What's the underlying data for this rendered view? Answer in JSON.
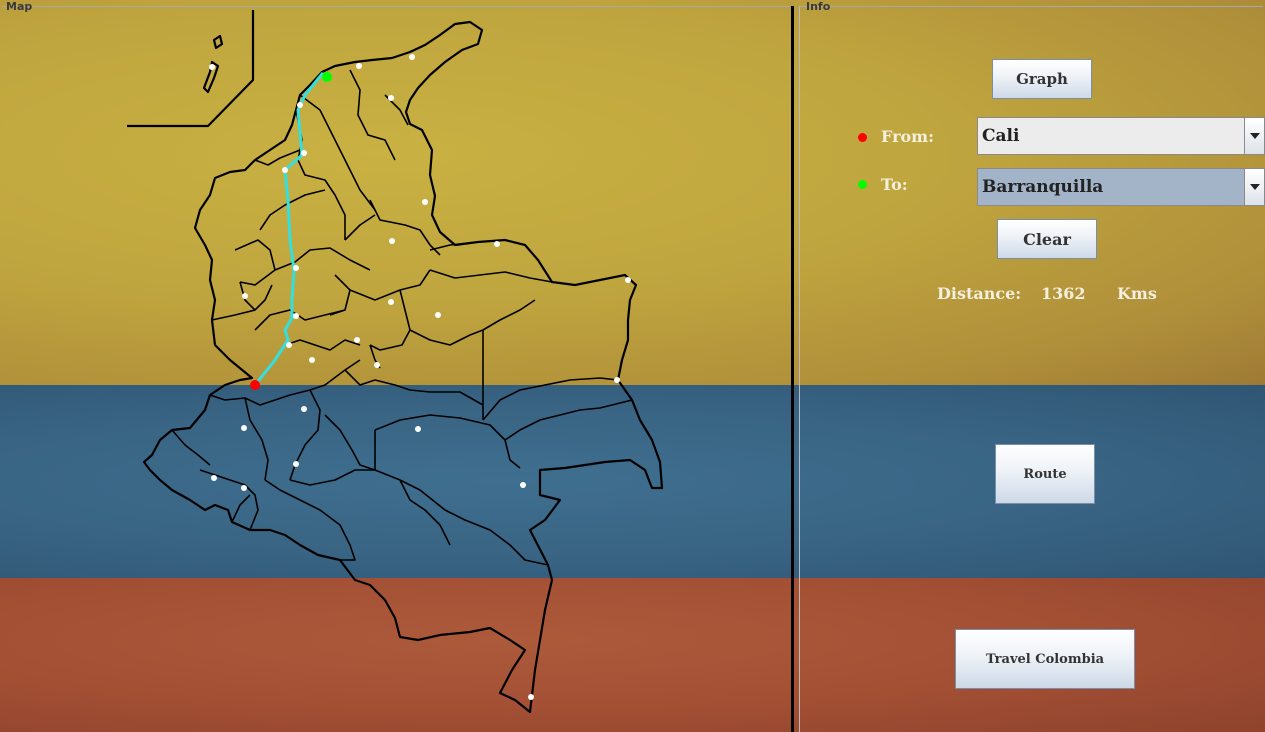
{
  "map_panel": {
    "title": "Map"
  },
  "info_panel": {
    "title": "Info"
  },
  "buttons": {
    "graph": "Graph",
    "clear": "Clear",
    "route": "Route",
    "travel": "Travel Colombia"
  },
  "from": {
    "label": "From:",
    "value": "Cali",
    "marker_color": "#ff0000"
  },
  "to": {
    "label": "To:",
    "value": "Barranquilla",
    "marker_color": "#00ff00"
  },
  "distance": {
    "label": "Distance:",
    "value": "1362",
    "unit": "Kms"
  },
  "route_colors": {
    "path": "#33e0e0",
    "origin": "#ff0000",
    "destination": "#00ff00",
    "city_node": "#ffffff"
  }
}
